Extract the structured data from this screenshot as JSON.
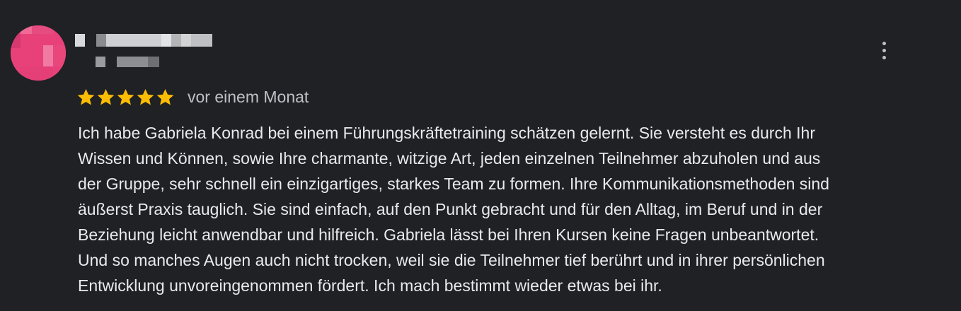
{
  "review": {
    "author_name_hidden": true,
    "rating": 5,
    "rating_max": 5,
    "time_label": "vor einem Monat",
    "text_lines": [
      "Ich habe Gabriela Konrad bei einem Führungskräftetraining schätzen gelernt. Sie versteht es durch Ihr",
      "Wissen und Können, sowie Ihre charmante, witzige Art, jeden einzelnen Teilnehmer abzuholen und aus",
      "der Gruppe, sehr schnell ein einzigartiges, starkes Team zu formen. Ihre Kommunikationsmethoden sind",
      "äußerst Praxis tauglich. Sie sind einfach, auf den Punkt gebracht und für den Alltag, im Beruf und in der",
      "Beziehung leicht anwendbar und hilfreich. Gabriela lässt bei Ihren Kursen keine Fragen unbeantwortet.",
      "Und so manches Augen auch nicht trocken, weil sie die Teilnehmer tief berührt und in ihrer persönlichen",
      "Entwicklung unvoreingenommen fördert. Ich mach bestimmt wieder etwas bei ihr."
    ]
  },
  "icons": {
    "star": "star-icon",
    "more": "more-vert-icon"
  },
  "colors": {
    "background": "#202124",
    "star": "#fbbc04",
    "avatar": "#e8417a",
    "text": "#e8eaed",
    "secondary_text": "#bdc1c6"
  }
}
